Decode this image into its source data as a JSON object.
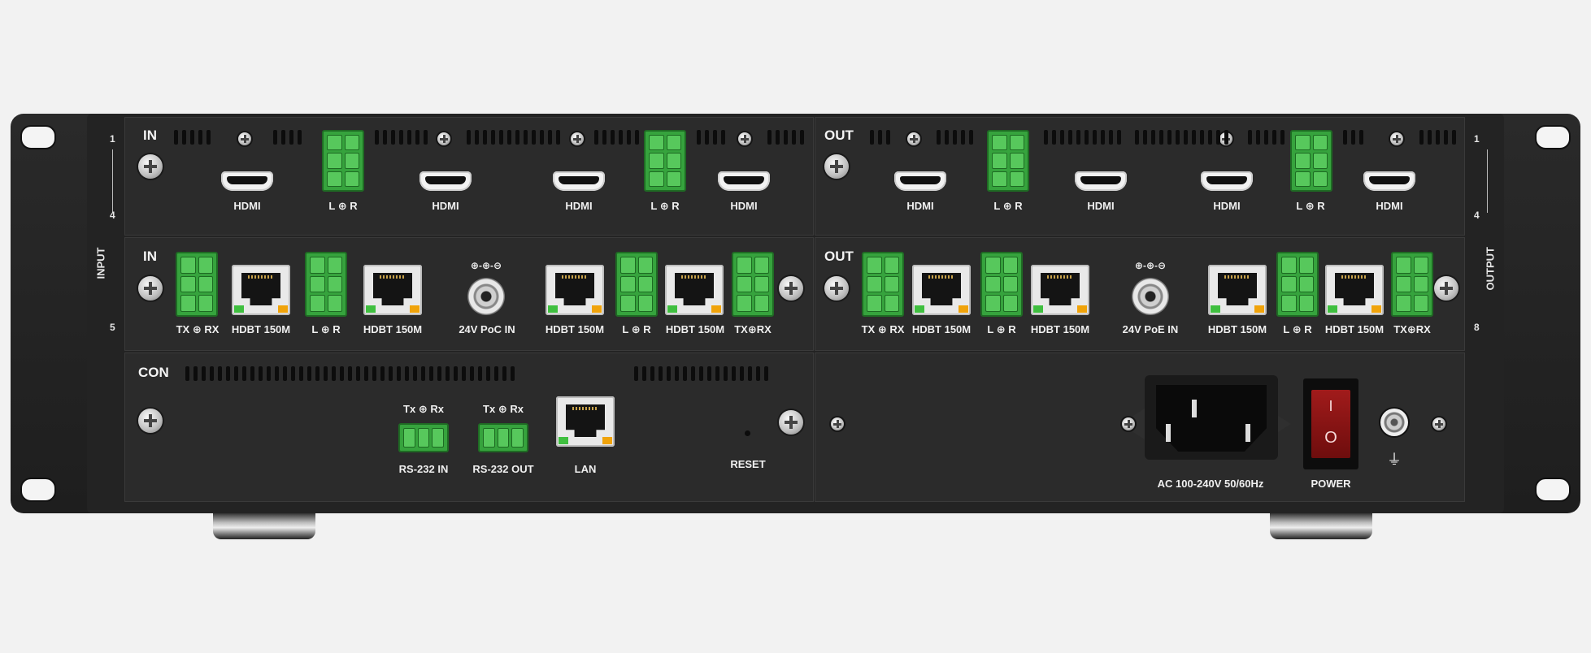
{
  "input_hdmi_module": {
    "title": "IN",
    "ports": [
      "HDMI",
      "L ⊕ R",
      "HDMI",
      "HDMI",
      "L ⊕ R",
      "HDMI"
    ]
  },
  "output_hdmi_module": {
    "title": "OUT",
    "ports": [
      "HDMI",
      "L ⊕ R",
      "HDMI",
      "HDMI",
      "L ⊕ R",
      "HDMI"
    ]
  },
  "input_hdbt_module": {
    "title": "IN",
    "ports": [
      "TX ⊕ RX",
      "HDBT 150M",
      "L ⊕ R",
      "HDBT 150M",
      "24V PoC IN",
      "HDBT 150M",
      "L ⊕ R",
      "HDBT 150M",
      "TX⊕RX"
    ],
    "bnc_symbol": "⊕-⊕-⊖"
  },
  "output_hdbt_module": {
    "title": "OUT",
    "ports": [
      "TX ⊕ RX",
      "HDBT 150M",
      "L ⊕ R",
      "HDBT 150M",
      "24V PoE IN",
      "HDBT 150M",
      "L ⊕ R",
      "HDBT 150M",
      "TX⊕RX"
    ],
    "bnc_symbol": "⊕-⊕-⊖"
  },
  "control_module": {
    "title": "CON",
    "rs232_in_top": "Tx ⊕ Rx",
    "rs232_in": "RS-232 IN",
    "rs232_out_top": "Tx ⊕ Rx",
    "rs232_out": "RS-232 OUT",
    "lan": "LAN",
    "reset": "RESET"
  },
  "power_module": {
    "ac_label": "AC 100-240V 50/60Hz",
    "power_label": "POWER",
    "switch_on": "I",
    "switch_off": "O",
    "ground_symbol": "⏚"
  },
  "side_labels": {
    "left_title": "INPUT",
    "right_title": "OUTPUT",
    "left_top": "1",
    "left_mid": "4",
    "left_bottom": "5",
    "right_top": "1",
    "right_mid": "4",
    "right_bottom": "8"
  }
}
